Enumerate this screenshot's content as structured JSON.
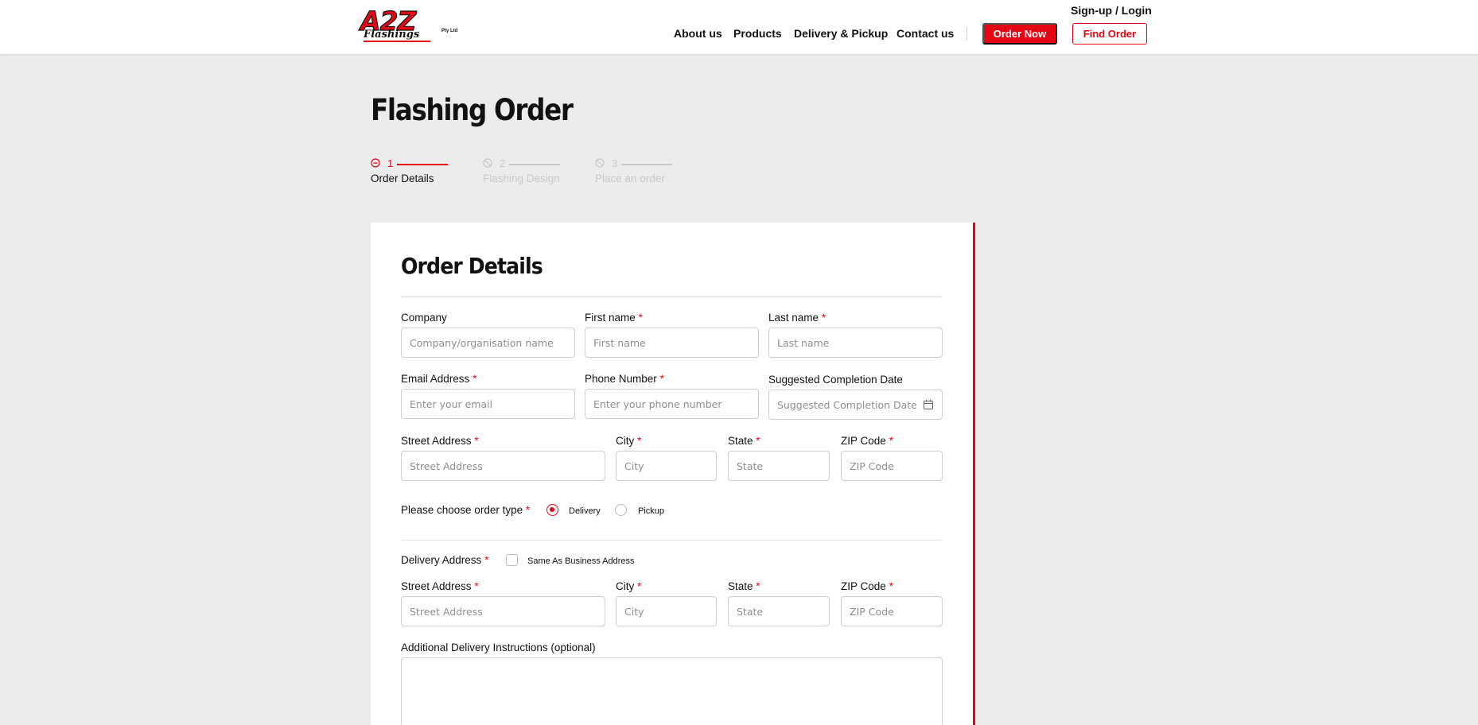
{
  "header": {
    "logo_main": "A2Z",
    "logo_sub": "Flashings",
    "logo_pty": "Pty Ltd",
    "signup": "Sign-up / Login",
    "nav": [
      "About us",
      "Products",
      "Delivery & Pickup",
      "Contact us"
    ],
    "order_now": "Order Now",
    "find_order": "Find Order"
  },
  "page_title": "Flashing Order",
  "steps": [
    {
      "number": "1",
      "label": "Order Details",
      "state": "active"
    },
    {
      "number": "2",
      "label": "Flashing Design",
      "state": "inactive"
    },
    {
      "number": "3",
      "label": "Place an order",
      "state": "inactive"
    }
  ],
  "form": {
    "title": "Order Details",
    "required_mark": "*",
    "company": {
      "label": "Company",
      "placeholder": "Company/organisation name"
    },
    "first_name": {
      "label": "First name",
      "placeholder": "First name"
    },
    "last_name": {
      "label": "Last name",
      "placeholder": "Last name"
    },
    "email": {
      "label": "Email Address",
      "placeholder": "Enter your email"
    },
    "phone": {
      "label": "Phone Number",
      "placeholder": "Enter your phone number"
    },
    "completion_date": {
      "label": "Suggested Completion Date",
      "placeholder": "Suggested Completion Date"
    },
    "street": {
      "label": "Street Address",
      "placeholder": "Street Address"
    },
    "city": {
      "label": "City",
      "placeholder": "City"
    },
    "state": {
      "label": "State",
      "placeholder": "State"
    },
    "zip": {
      "label": "ZIP Code",
      "placeholder": "ZIP Code"
    },
    "order_type": {
      "label": "Please choose order type",
      "options": [
        "Delivery",
        "Pickup"
      ],
      "selected": "Delivery"
    },
    "delivery_address": {
      "label": "Delivery Address",
      "same_as_label": "Same As Business Address",
      "same_as_checked": false
    },
    "delivery_street": {
      "label": "Street Address",
      "placeholder": "Street Address"
    },
    "delivery_city": {
      "label": "City",
      "placeholder": "City"
    },
    "delivery_state": {
      "label": "State",
      "placeholder": "State"
    },
    "delivery_zip": {
      "label": "ZIP Code",
      "placeholder": "ZIP Code"
    },
    "instructions": {
      "label": "Additional Delivery Instructions (optional)",
      "placeholder": ""
    }
  },
  "colors": {
    "accent": "#e30613",
    "background": "#ececec",
    "inactive": "#c8c8c8"
  }
}
